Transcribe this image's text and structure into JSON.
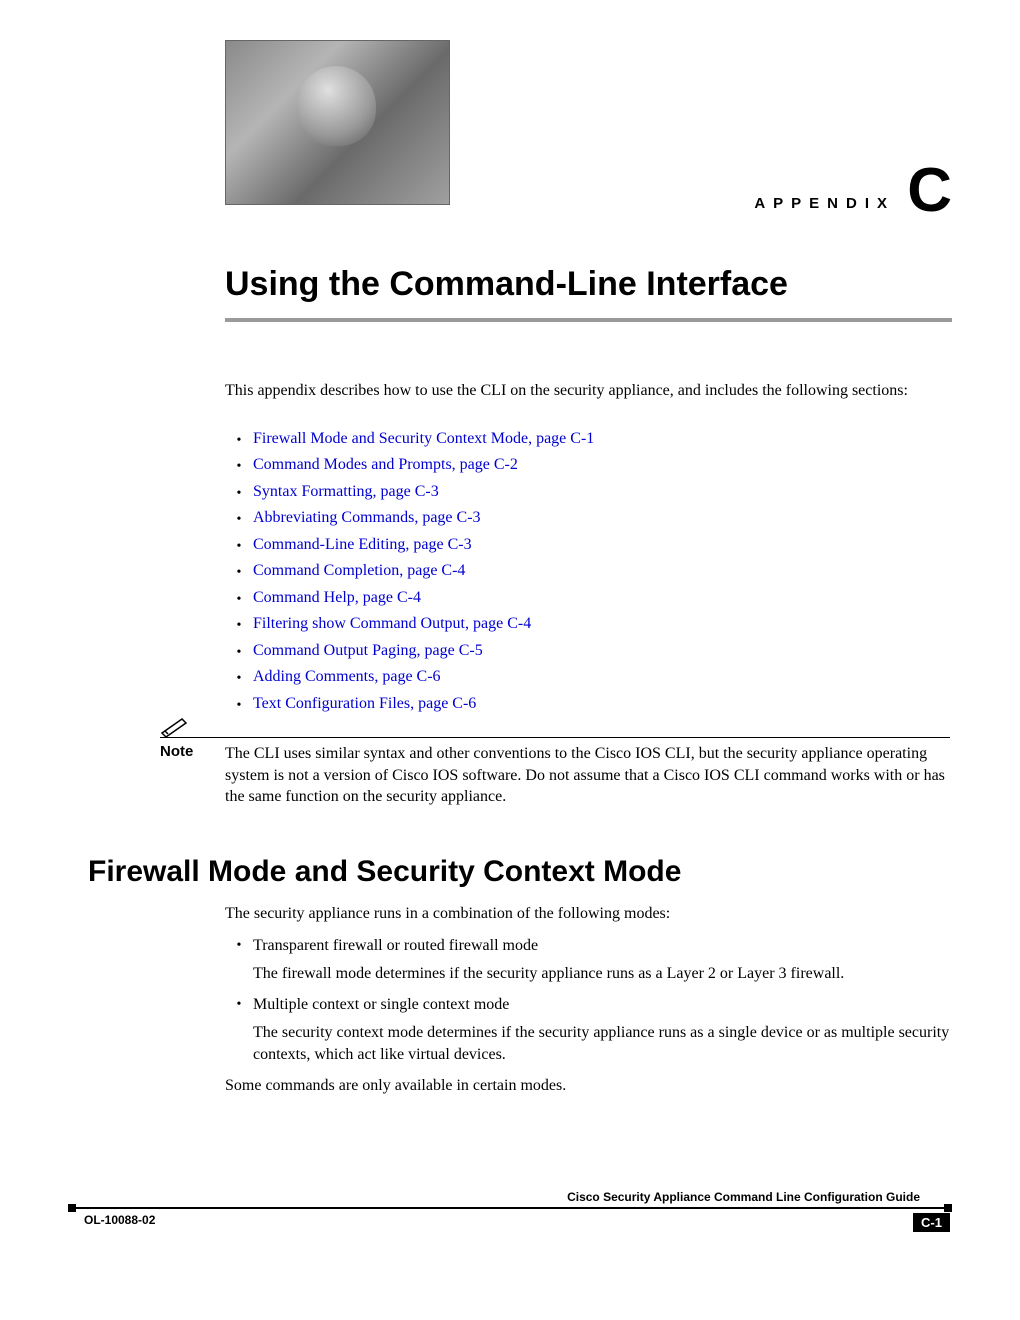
{
  "header": {
    "appendix_label": "APPENDIX",
    "appendix_letter": "C",
    "title": "Using the Command-Line Interface"
  },
  "intro": "This appendix describes how to use the CLI on the security appliance, and includes the following sections:",
  "toc": [
    "Firewall Mode and Security Context Mode, page C-1",
    "Command Modes and Prompts, page C-2",
    "Syntax Formatting, page C-3",
    "Abbreviating Commands, page C-3",
    "Command-Line Editing, page C-3",
    "Command Completion, page C-4",
    "Command Help, page C-4",
    "Filtering show Command Output, page C-4",
    "Command Output Paging, page C-5",
    "Adding Comments, page C-6",
    "Text Configuration Files, page C-6"
  ],
  "note": {
    "label": "Note",
    "text": "The CLI uses similar syntax and other conventions to the Cisco IOS CLI, but the security appliance operating system is not a version of Cisco IOS software. Do not assume that a Cisco IOS CLI command works with or has the same function on the security appliance."
  },
  "section": {
    "heading": "Firewall Mode and Security Context Mode",
    "lead": "The security appliance runs in a combination of the following modes:",
    "modes": [
      {
        "name": "Transparent firewall or routed firewall mode",
        "desc": "The firewall mode determines if the security appliance runs as a Layer 2 or Layer 3 firewall."
      },
      {
        "name": "Multiple context or single context mode",
        "desc": "The security context mode determines if the security appliance runs as a single device or as multiple security contexts, which act like virtual devices."
      }
    ],
    "closing": "Some commands are only available in certain modes."
  },
  "footer": {
    "guide": "Cisco Security Appliance Command Line Configuration Guide",
    "doc_id": "OL-10088-02",
    "page_num": "C-1"
  }
}
